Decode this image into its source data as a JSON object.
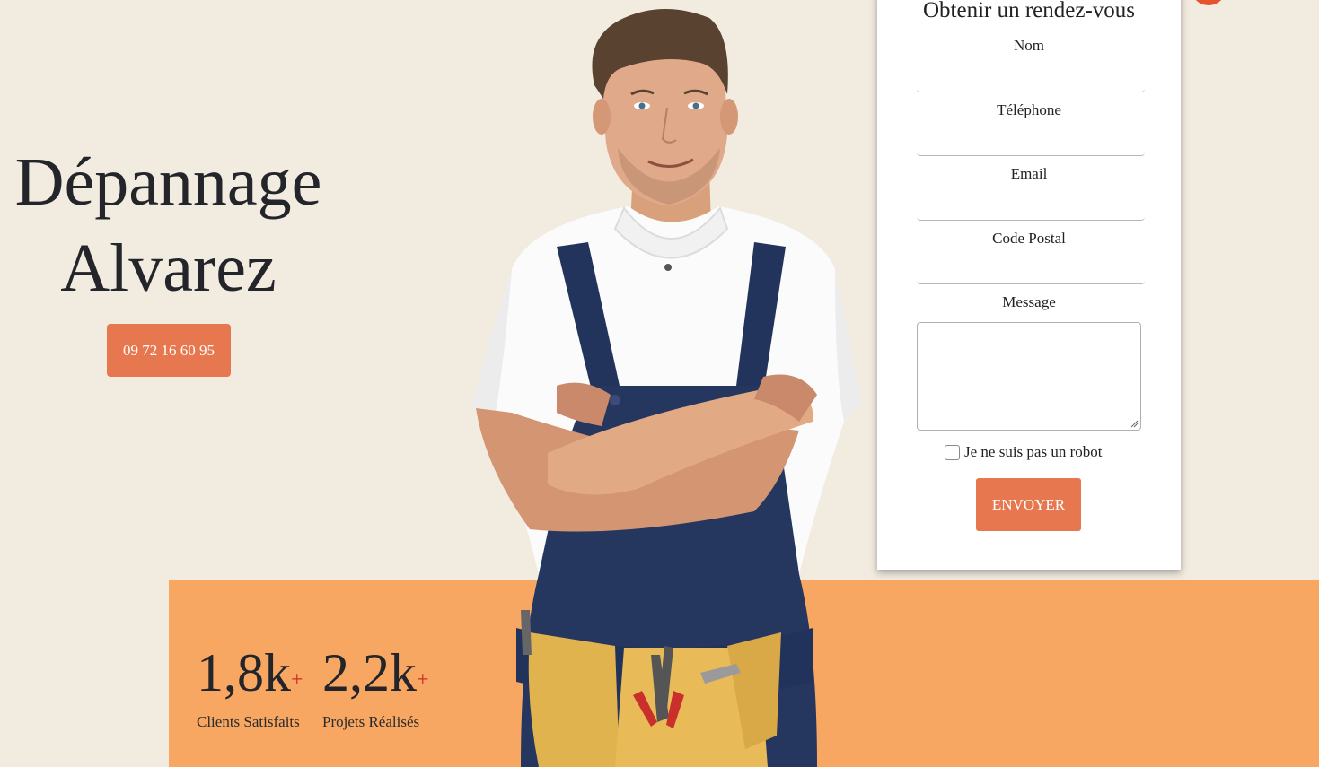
{
  "hero": {
    "title_line1": "Dépannage",
    "title_line2": "Alvarez",
    "phone": "09 72 16 60 95"
  },
  "stats": [
    {
      "value": "1,8k",
      "plus": "+",
      "label": "Clients Satisfaits"
    },
    {
      "value": "2,2k",
      "plus": "+",
      "label": "Projets Réalisés"
    }
  ],
  "form": {
    "title": "Obtenir un rendez-vous",
    "fields": [
      {
        "label": "Nom",
        "value": ""
      },
      {
        "label": "Téléphone",
        "value": ""
      },
      {
        "label": "Email",
        "value": ""
      },
      {
        "label": "Code Postal",
        "value": ""
      }
    ],
    "message_label": "Message",
    "message_value": "",
    "robot_label": "Je ne suis pas un robot",
    "robot_checked": false,
    "submit_label": "ENVOYER"
  },
  "colors": {
    "background": "#f2ebe0",
    "accent": "#e7774f",
    "stats_band": "#f8a762",
    "plus": "#c4302b",
    "corner_button": "#e5532b"
  }
}
